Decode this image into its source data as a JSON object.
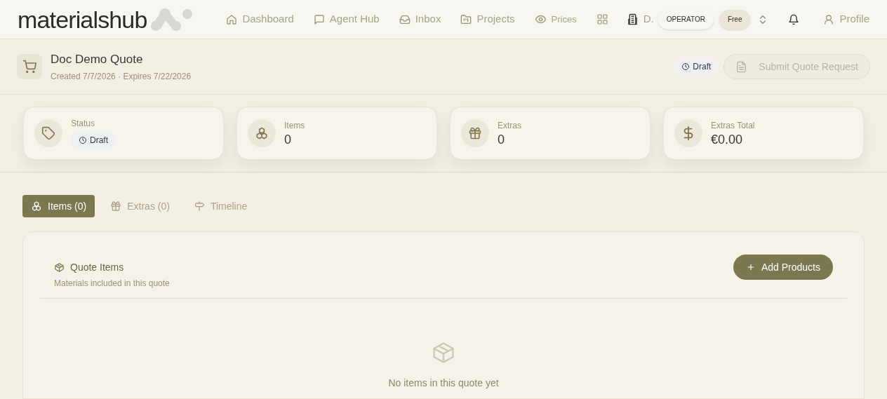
{
  "brand": {
    "name": "materialshub"
  },
  "nav": [
    {
      "label": "Dashboard"
    },
    {
      "label": "Agent Hub"
    },
    {
      "label": "Inbox"
    },
    {
      "label": "Projects"
    },
    {
      "label": "Prices"
    }
  ],
  "org": {
    "label": "D.",
    "role": "OPERATOR",
    "plan": "Free"
  },
  "profile": {
    "label": "Profile"
  },
  "quote": {
    "title": "Doc Demo Quote",
    "meta": "Created 7/7/2026 · Expires 7/22/2026",
    "status": "Draft",
    "submit": {
      "label": "Submit Quote Request",
      "disabled": true
    }
  },
  "stats": [
    {
      "label": "Status",
      "kind": "badge",
      "value": "Draft"
    },
    {
      "label": "Items",
      "kind": "number",
      "value": "0"
    },
    {
      "label": "Extras",
      "kind": "number",
      "value": "0"
    },
    {
      "label": "Extras Total",
      "kind": "number",
      "value": "€0.00"
    }
  ],
  "tabs": [
    {
      "label": "Items (0)",
      "selected": true
    },
    {
      "label": "Extras (0)",
      "selected": false
    },
    {
      "label": "Timeline",
      "selected": false
    }
  ],
  "panel": {
    "title": "Quote Items",
    "subtitle": "Materials included in this quote",
    "button": "Add Products",
    "empty": "No items in this quote yet"
  }
}
